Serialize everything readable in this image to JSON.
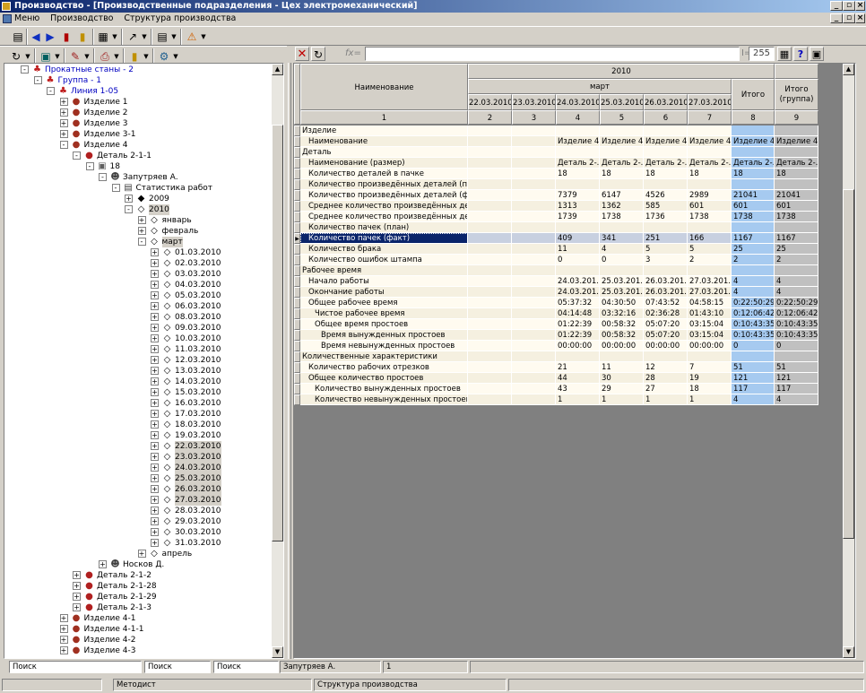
{
  "window": {
    "title": "Производство - [Производственные подразделения - Цех электромеханический]"
  },
  "menu": [
    "Меню",
    "Производство",
    "Структура производства"
  ],
  "formula": {
    "label": "fx=",
    "value": "",
    "field_name_value": "255",
    "field_name_prefix": "I="
  },
  "tree": [
    {
      "label": "Прокатные станы - 2",
      "level": 2,
      "exp": "-",
      "icon": "workshop-icon",
      "blue": true
    },
    {
      "label": "Группа - 1",
      "level": 3,
      "exp": "-",
      "icon": "workshop-icon",
      "blue": true
    },
    {
      "label": "Линия 1-05",
      "level": 4,
      "exp": "-",
      "icon": "workshop-icon",
      "blue": true
    },
    {
      "label": "Изделие 1",
      "level": 5,
      "exp": "+",
      "icon": "product-icon"
    },
    {
      "label": "Изделие 2",
      "level": 5,
      "exp": "+",
      "icon": "product-icon"
    },
    {
      "label": "Изделие 3",
      "level": 5,
      "exp": "+",
      "icon": "product-icon"
    },
    {
      "label": "Изделие 3-1",
      "level": 5,
      "exp": "+",
      "icon": "product-icon"
    },
    {
      "label": "Изделие 4",
      "level": 5,
      "exp": "-",
      "icon": "product-icon"
    },
    {
      "label": "Деталь 2-1-1",
      "level": 6,
      "exp": "-",
      "icon": "part-icon"
    },
    {
      "label": "18",
      "level": 7,
      "exp": "-",
      "icon": "machine-icon"
    },
    {
      "label": "Запутряев А.",
      "level": 8,
      "exp": "-",
      "icon": "worker-icon"
    },
    {
      "label": "Статистика работ",
      "level": 9,
      "exp": "-",
      "icon": "document-icon"
    },
    {
      "label": "2009",
      "level": 10,
      "exp": "+",
      "icon": "diamond-filled-icon"
    },
    {
      "label": "2010",
      "level": 10,
      "exp": "-",
      "icon": "diamond-icon",
      "sel": true
    },
    {
      "label": "январь",
      "level": 11,
      "exp": "+",
      "icon": "diamond-icon"
    },
    {
      "label": "февраль",
      "level": 11,
      "exp": "+",
      "icon": "diamond-icon"
    },
    {
      "label": "март",
      "level": 11,
      "exp": "-",
      "icon": "diamond-icon",
      "sel": true
    },
    {
      "label": "01.03.2010",
      "level": 12,
      "exp": "+",
      "icon": "diamond-icon"
    },
    {
      "label": "02.03.2010",
      "level": 12,
      "exp": "+",
      "icon": "diamond-icon"
    },
    {
      "label": "03.03.2010",
      "level": 12,
      "exp": "+",
      "icon": "diamond-icon"
    },
    {
      "label": "04.03.2010",
      "level": 12,
      "exp": "+",
      "icon": "diamond-icon"
    },
    {
      "label": "05.03.2010",
      "level": 12,
      "exp": "+",
      "icon": "diamond-icon"
    },
    {
      "label": "06.03.2010",
      "level": 12,
      "exp": "+",
      "icon": "diamond-icon"
    },
    {
      "label": "08.03.2010",
      "level": 12,
      "exp": "+",
      "icon": "diamond-icon"
    },
    {
      "label": "09.03.2010",
      "level": 12,
      "exp": "+",
      "icon": "diamond-icon"
    },
    {
      "label": "10.03.2010",
      "level": 12,
      "exp": "+",
      "icon": "diamond-icon"
    },
    {
      "label": "11.03.2010",
      "level": 12,
      "exp": "+",
      "icon": "diamond-icon"
    },
    {
      "label": "12.03.2010",
      "level": 12,
      "exp": "+",
      "icon": "diamond-icon"
    },
    {
      "label": "13.03.2010",
      "level": 12,
      "exp": "+",
      "icon": "diamond-icon"
    },
    {
      "label": "14.03.2010",
      "level": 12,
      "exp": "+",
      "icon": "diamond-icon"
    },
    {
      "label": "15.03.2010",
      "level": 12,
      "exp": "+",
      "icon": "diamond-icon"
    },
    {
      "label": "16.03.2010",
      "level": 12,
      "exp": "+",
      "icon": "diamond-icon"
    },
    {
      "label": "17.03.2010",
      "level": 12,
      "exp": "+",
      "icon": "diamond-icon"
    },
    {
      "label": "18.03.2010",
      "level": 12,
      "exp": "+",
      "icon": "diamond-icon"
    },
    {
      "label": "19.03.2010",
      "level": 12,
      "exp": "+",
      "icon": "diamond-icon"
    },
    {
      "label": "22.03.2010",
      "level": 12,
      "exp": "+",
      "icon": "diamond-icon",
      "sel": true
    },
    {
      "label": "23.03.2010",
      "level": 12,
      "exp": "+",
      "icon": "diamond-icon",
      "sel": true
    },
    {
      "label": "24.03.2010",
      "level": 12,
      "exp": "+",
      "icon": "diamond-icon",
      "sel": true
    },
    {
      "label": "25.03.2010",
      "level": 12,
      "exp": "+",
      "icon": "diamond-icon",
      "sel": true
    },
    {
      "label": "26.03.2010",
      "level": 12,
      "exp": "+",
      "icon": "diamond-icon",
      "sel": true
    },
    {
      "label": "27.03.2010",
      "level": 12,
      "exp": "+",
      "icon": "diamond-icon",
      "sel": true
    },
    {
      "label": "28.03.2010",
      "level": 12,
      "exp": "+",
      "icon": "diamond-icon"
    },
    {
      "label": "29.03.2010",
      "level": 12,
      "exp": "+",
      "icon": "diamond-icon"
    },
    {
      "label": "30.03.2010",
      "level": 12,
      "exp": "+",
      "icon": "diamond-icon"
    },
    {
      "label": "31.03.2010",
      "level": 12,
      "exp": "+",
      "icon": "diamond-icon"
    },
    {
      "label": "апрель",
      "level": 11,
      "exp": "+",
      "icon": "diamond-icon"
    },
    {
      "label": "Носков Д.",
      "level": 8,
      "exp": "+",
      "icon": "worker-icon"
    },
    {
      "label": "Деталь 2-1-2",
      "level": 6,
      "exp": "+",
      "icon": "part-icon"
    },
    {
      "label": "Деталь 2-1-28",
      "level": 6,
      "exp": "+",
      "icon": "part-icon"
    },
    {
      "label": "Деталь 2-1-29",
      "level": 6,
      "exp": "+",
      "icon": "part-icon"
    },
    {
      "label": "Деталь 2-1-3",
      "level": 6,
      "exp": "+",
      "icon": "part-icon"
    },
    {
      "label": "Изделие 4-1",
      "level": 5,
      "exp": "+",
      "icon": "product-icon"
    },
    {
      "label": "Изделие 4-1-1",
      "level": 5,
      "exp": "+",
      "icon": "product-icon"
    },
    {
      "label": "Изделие 4-2",
      "level": 5,
      "exp": "+",
      "icon": "product-icon"
    },
    {
      "label": "Изделие 4-3",
      "level": 5,
      "exp": "+",
      "icon": "product-icon"
    }
  ],
  "grid": {
    "header_name": "Наименование",
    "year": "2010",
    "month": "март",
    "dates": [
      "22.03.2010",
      "23.03.2010",
      "24.03.2010",
      "25.03.2010",
      "26.03.2010",
      "27.03.2010"
    ],
    "total": "Итого",
    "total_group": "Итого (группа)",
    "col_numbers": [
      "1",
      "2",
      "3",
      "4",
      "5",
      "6",
      "7",
      "8",
      "9"
    ],
    "rows": [
      {
        "name": "Изделие",
        "indent": 0,
        "group": true,
        "vals": [
          "",
          "",
          "",
          "",
          "",
          "",
          "",
          ""
        ]
      },
      {
        "name": "Наименование",
        "indent": 1,
        "vals": [
          "",
          "",
          "Изделие 4",
          "Изделие 4",
          "Изделие 4",
          "Изделие 4",
          "Изделие 4",
          "Изделие 4"
        ]
      },
      {
        "name": "Деталь",
        "indent": 0,
        "group": true,
        "vals": [
          "",
          "",
          "",
          "",
          "",
          "",
          "",
          ""
        ]
      },
      {
        "name": "Наименование (размер)",
        "indent": 1,
        "vals": [
          "",
          "",
          "Деталь 2-...",
          "Деталь 2-...",
          "Деталь 2-...",
          "Деталь 2-...",
          "Деталь 2-...",
          "Деталь 2-..."
        ]
      },
      {
        "name": "Количество деталей в пачке",
        "indent": 1,
        "vals": [
          "",
          "",
          "18",
          "18",
          "18",
          "18",
          "18",
          "18"
        ]
      },
      {
        "name": "Количество произведённых деталей (план)",
        "indent": 1,
        "vals": [
          "",
          "",
          "",
          "",
          "",
          "",
          "",
          ""
        ]
      },
      {
        "name": "Количество произведённых деталей (факт)",
        "indent": 1,
        "vals": [
          "",
          "",
          "7379",
          "6147",
          "4526",
          "2989",
          "21041",
          "21041"
        ]
      },
      {
        "name": "Среднее количество произведённых детал...",
        "indent": 1,
        "vals": [
          "",
          "",
          "1313",
          "1362",
          "585",
          "601",
          "601",
          "601"
        ]
      },
      {
        "name": "Среднее количество произведённых детал...",
        "indent": 1,
        "vals": [
          "",
          "",
          "1739",
          "1738",
          "1736",
          "1738",
          "1738",
          "1738"
        ]
      },
      {
        "name": "Количество пачек (план)",
        "indent": 1,
        "vals": [
          "",
          "",
          "",
          "",
          "",
          "",
          "",
          ""
        ]
      },
      {
        "name": "Количество пачек (факт)",
        "indent": 1,
        "current": true,
        "vals": [
          "",
          "",
          "409",
          "341",
          "251",
          "166",
          "1167",
          "1167"
        ]
      },
      {
        "name": "Количество брака",
        "indent": 1,
        "vals": [
          "",
          "",
          "11",
          "4",
          "5",
          "5",
          "25",
          "25"
        ]
      },
      {
        "name": "Количество ошибок штампа",
        "indent": 1,
        "vals": [
          "",
          "",
          "0",
          "0",
          "3",
          "2",
          "2",
          "2"
        ]
      },
      {
        "name": "Рабочее время",
        "indent": 0,
        "group": true,
        "vals": [
          "",
          "",
          "",
          "",
          "",
          "",
          "",
          ""
        ]
      },
      {
        "name": "Начало работы",
        "indent": 1,
        "vals": [
          "",
          "",
          "24.03.201...",
          "25.03.201...",
          "26.03.201...",
          "27.03.201...",
          "4",
          "4"
        ]
      },
      {
        "name": "Окончание работы",
        "indent": 1,
        "vals": [
          "",
          "",
          "24.03.201...",
          "25.03.201...",
          "26.03.201...",
          "27.03.201...",
          "4",
          "4"
        ]
      },
      {
        "name": "Общее рабочее время",
        "indent": 1,
        "vals": [
          "",
          "",
          "05:37:32",
          "04:30:50",
          "07:43:52",
          "04:58:15",
          "0:22:50:29",
          "0:22:50:29"
        ]
      },
      {
        "name": "Чистое рабочее время",
        "indent": 2,
        "vals": [
          "",
          "",
          "04:14:48",
          "03:32:16",
          "02:36:28",
          "01:43:10",
          "0:12:06:42",
          "0:12:06:42"
        ]
      },
      {
        "name": "Общее время простоев",
        "indent": 2,
        "vals": [
          "",
          "",
          "01:22:39",
          "00:58:32",
          "05:07:20",
          "03:15:04",
          "0:10:43:35",
          "0:10:43:35"
        ]
      },
      {
        "name": "Время вынужденных простоев",
        "indent": 3,
        "vals": [
          "",
          "",
          "01:22:39",
          "00:58:32",
          "05:07:20",
          "03:15:04",
          "0:10:43:35",
          "0:10:43:35"
        ]
      },
      {
        "name": "Время невынужденных простоев",
        "indent": 3,
        "vals": [
          "",
          "",
          "00:00:00",
          "00:00:00",
          "00:00:00",
          "00:00:00",
          "0",
          "0"
        ]
      },
      {
        "name": "Количественные характеристики",
        "indent": 0,
        "group": true,
        "vals": [
          "",
          "",
          "",
          "",
          "",
          "",
          "",
          ""
        ]
      },
      {
        "name": "Количество рабочих отрезков",
        "indent": 1,
        "vals": [
          "",
          "",
          "21",
          "11",
          "12",
          "7",
          "51",
          "51"
        ]
      },
      {
        "name": "Общее количество простоев",
        "indent": 1,
        "vals": [
          "",
          "",
          "44",
          "30",
          "28",
          "19",
          "121",
          "121"
        ]
      },
      {
        "name": "Количество вынужденных простоев",
        "indent": 2,
        "vals": [
          "",
          "",
          "43",
          "29",
          "27",
          "18",
          "117",
          "117"
        ]
      },
      {
        "name": "Количество невынужденных простоев",
        "indent": 2,
        "vals": [
          "",
          "",
          "1",
          "1",
          "1",
          "1",
          "4",
          "4"
        ]
      }
    ]
  },
  "status": {
    "search1": "Поиск",
    "search2": "Поиск",
    "search3": "Поиск",
    "user": "Запутряев А.",
    "count": "1",
    "role": "Методист",
    "section": "Структура производства"
  },
  "colors": {
    "total_col": "#a6caf0",
    "group_col": "#c0c0c0",
    "row_light": "#fffbf0",
    "row_dark": "#f5f0e0",
    "selected": "#0a246a"
  }
}
